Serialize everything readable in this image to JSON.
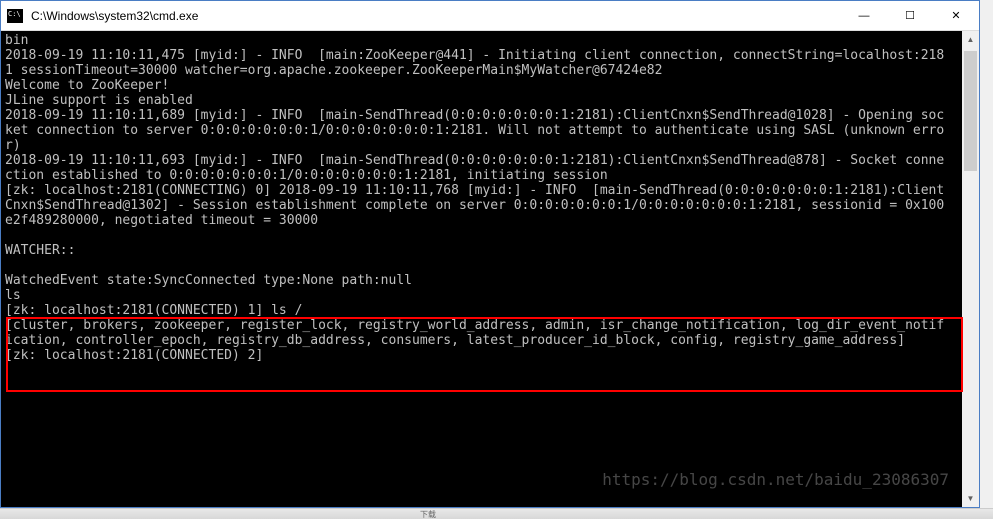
{
  "window": {
    "title": "C:\\Windows\\system32\\cmd.exe"
  },
  "controls": {
    "minimize": "—",
    "maximize": "☐",
    "close": "✕"
  },
  "console_lines": {
    "l0": "bin",
    "l1": "2018-09-19 11:10:11,475 [myid:] - INFO  [main:ZooKeeper@441] - Initiating client connection, connectString=localhost:218",
    "l2": "1 sessionTimeout=30000 watcher=org.apache.zookeeper.ZooKeeperMain$MyWatcher@67424e82",
    "l3": "Welcome to ZooKeeper!",
    "l4": "JLine support is enabled",
    "l5": "2018-09-19 11:10:11,689 [myid:] - INFO  [main-SendThread(0:0:0:0:0:0:0:1:2181):ClientCnxn$SendThread@1028] - Opening soc",
    "l6": "ket connection to server 0:0:0:0:0:0:0:1/0:0:0:0:0:0:0:1:2181. Will not attempt to authenticate using SASL (unknown erro",
    "l7": "r)",
    "l8": "2018-09-19 11:10:11,693 [myid:] - INFO  [main-SendThread(0:0:0:0:0:0:0:1:2181):ClientCnxn$SendThread@878] - Socket conne",
    "l9": "ction established to 0:0:0:0:0:0:0:1/0:0:0:0:0:0:0:1:2181, initiating session",
    "l10": "[zk: localhost:2181(CONNECTING) 0] 2018-09-19 11:10:11,768 [myid:] - INFO  [main-SendThread(0:0:0:0:0:0:0:1:2181):Client",
    "l11": "Cnxn$SendThread@1302] - Session establishment complete on server 0:0:0:0:0:0:0:1/0:0:0:0:0:0:0:1:2181, sessionid = 0x100",
    "l12": "e2f489280000, negotiated timeout = 30000",
    "l13": "",
    "l14": "WATCHER::",
    "l15": "",
    "l16": "WatchedEvent state:SyncConnected type:None path:null",
    "l17": "ls",
    "l18": "[zk: localhost:2181(CONNECTED) 1] ls /",
    "l19": "[cluster, brokers, zookeeper, register_lock, registry_world_address, admin, isr_change_notification, log_dir_event_notif",
    "l20": "ication, controller_epoch, registry_db_address, consumers, latest_producer_id_block, config, registry_game_address]",
    "l21": "[zk: localhost:2181(CONNECTED) 2]"
  },
  "watermark": "https://blog.csdn.net/baidu_23086307",
  "taskbar": {
    "fragment": "下载"
  }
}
